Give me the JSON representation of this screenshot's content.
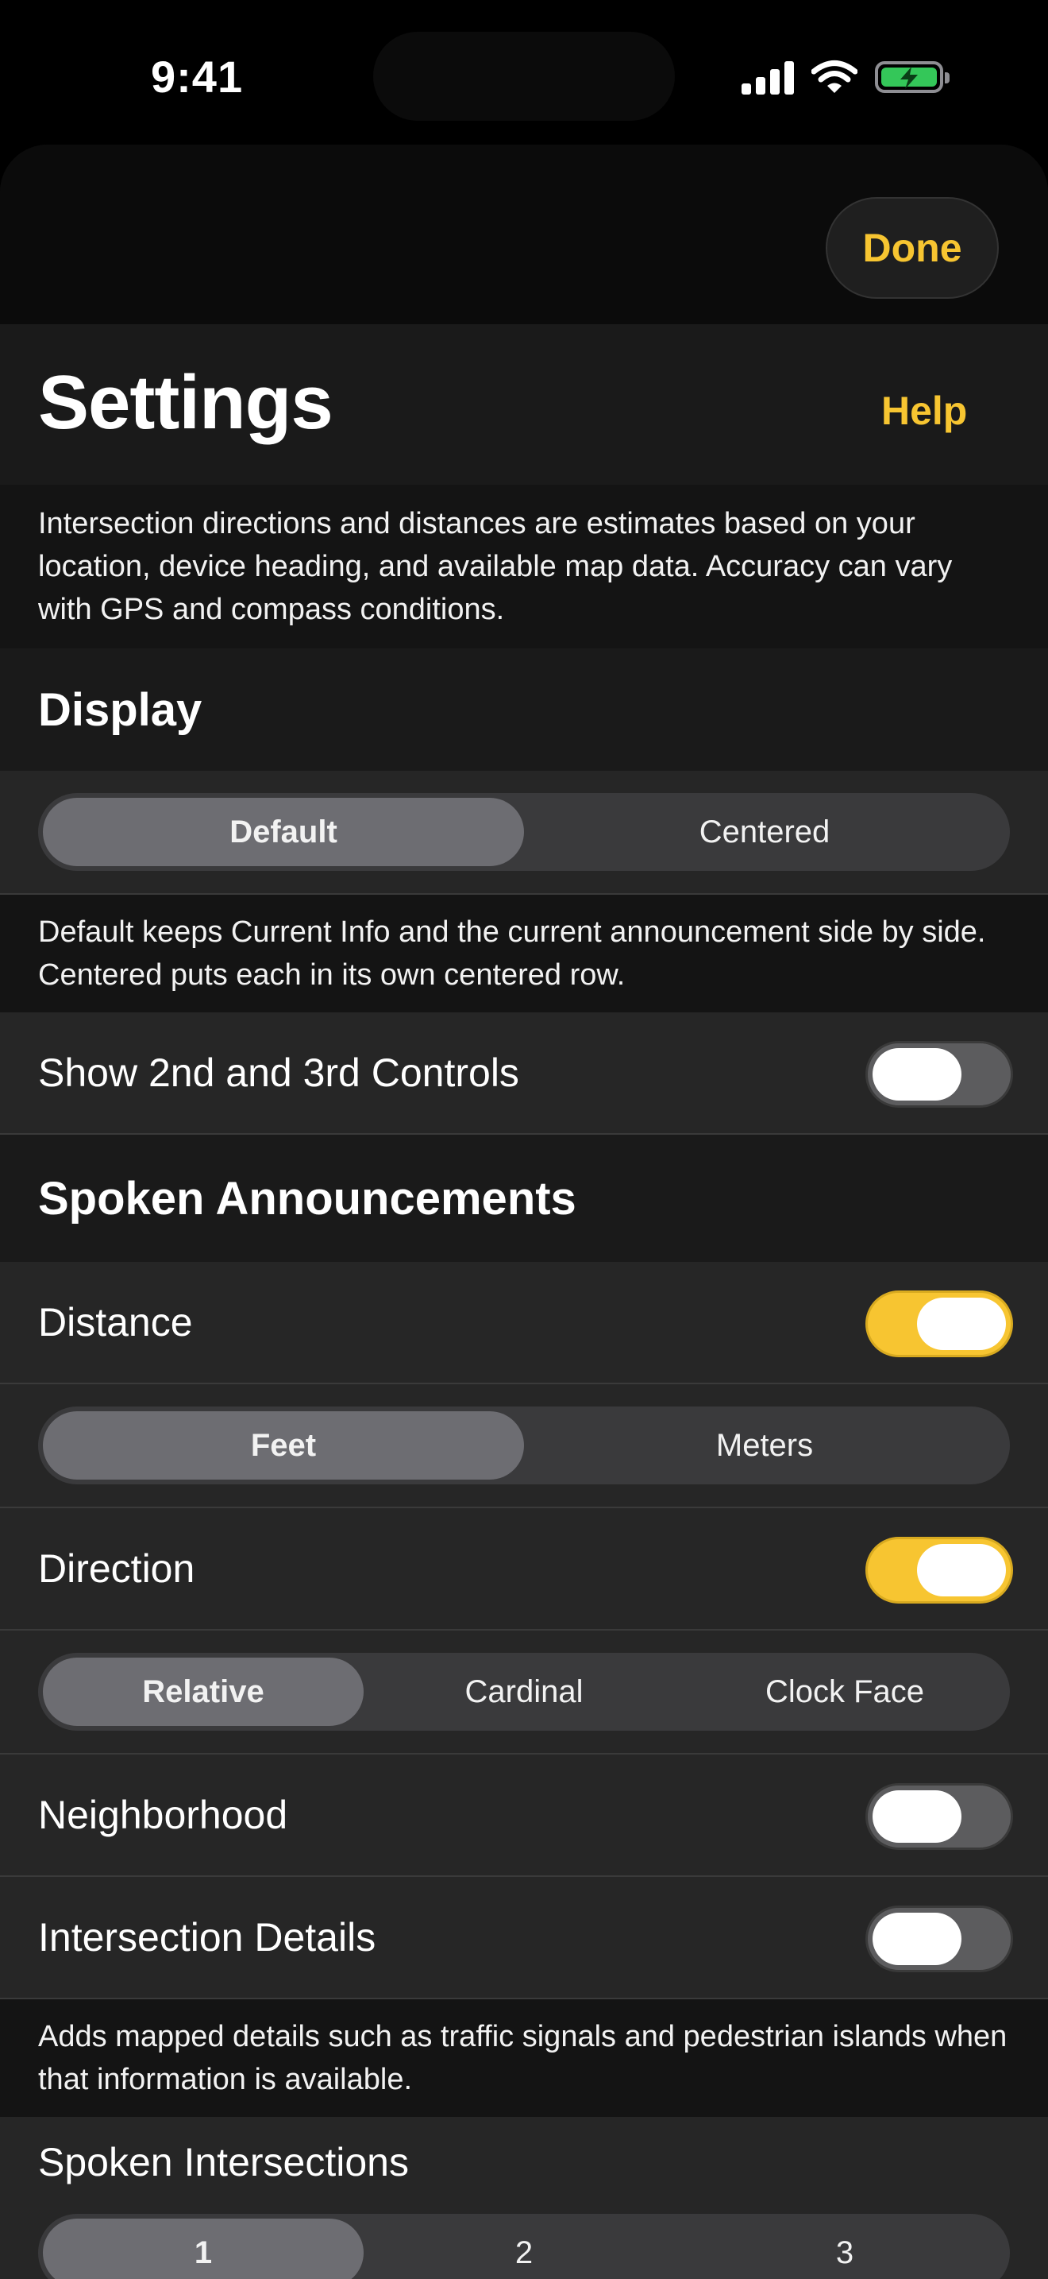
{
  "status": {
    "time": "9:41"
  },
  "sheet": {
    "done_label": "Done",
    "title": "Settings",
    "help_label": "Help"
  },
  "intro_note": "Intersection directions and distances are estimates based on your location, device heading, and available map data. Accuracy can vary with GPS and compass conditions.",
  "display": {
    "header": "Display",
    "layout_options": [
      "Default",
      "Centered"
    ],
    "layout_selected": "Default",
    "layout_note": "Default keeps Current Info and the current announcement side by side. Centered puts each in its own centered row.",
    "controls_label": "Show 2nd and 3rd Controls",
    "controls_on": false
  },
  "spoken": {
    "header": "Spoken Announcements",
    "distance_label": "Distance",
    "distance_on": true,
    "units": [
      "Feet",
      "Meters"
    ],
    "units_selected": "Feet",
    "direction_label": "Direction",
    "direction_on": true,
    "direction_modes": [
      "Relative",
      "Cardinal",
      "Clock Face"
    ],
    "direction_selected": "Relative",
    "neighborhood_label": "Neighborhood",
    "neighborhood_on": false,
    "intersection_details_label": "Intersection Details",
    "intersection_details_on": false,
    "details_note": "Adds mapped details such as traffic signals and pedestrian islands when that information is available.",
    "intersections_label": "Spoken Intersections",
    "intersections_options": [
      "1",
      "2",
      "3"
    ],
    "intersections_selected": "1"
  },
  "colors": {
    "accent": "#f7c531",
    "battery": "#34c759"
  }
}
